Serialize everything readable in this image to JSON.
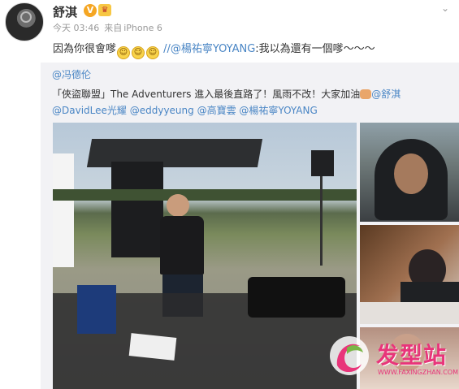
{
  "post": {
    "author": "舒淇",
    "meta": {
      "time": "今天 03:46",
      "source_prefix": "来自",
      "source": "iPhone 6"
    },
    "text_before": "因為你很會嗲",
    "emoji_name": "grin-emoji",
    "emoji_glyph": "ᵔᴥᵔ",
    "text_mention": "//@楊祐寧YOYANG",
    "text_after": ":我以為還有一個嗲～～～"
  },
  "repost": {
    "author": "@冯德伦",
    "text_part1": "「俠盜聯盟」The Adventurers 進入最後直路了！風雨不改！大家加油",
    "mention_1": "@舒淇",
    "mention_2": "@DavidLee光耀",
    "mention_3": "@eddyyeung",
    "mention_4": "@高寶雲",
    "mention_5": "@楊祐寧YOYANG"
  },
  "watermark": {
    "title": "发型站",
    "url": "WWW.FAXINGZHAN.COM"
  },
  "colors": {
    "link": "#4a86c5",
    "repost_bg": "#f2f2f5",
    "watermark": "#e8357a",
    "vip": "#f5a623"
  }
}
